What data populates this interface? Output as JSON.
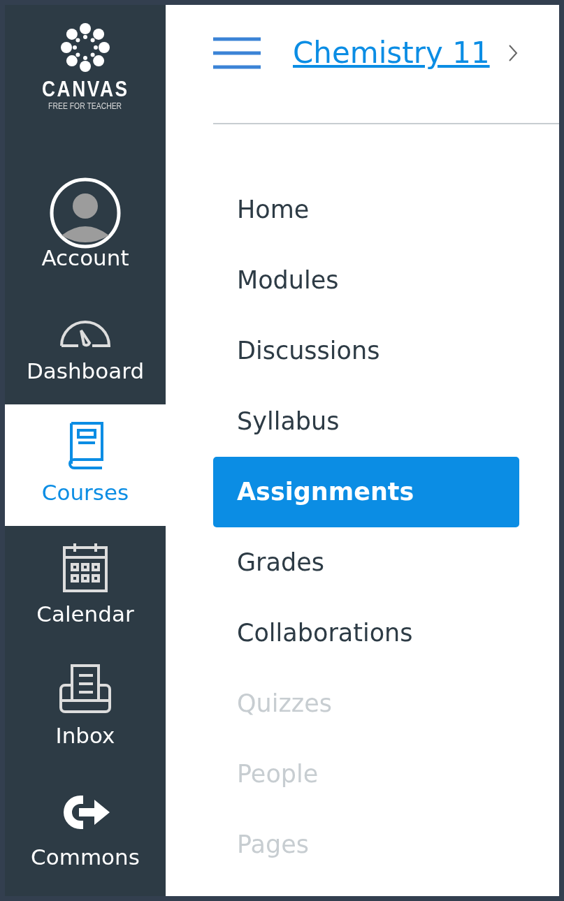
{
  "logo": {
    "title": "CANVAS",
    "subtitle": "FREE FOR TEACHER"
  },
  "global_nav": [
    {
      "kind": "account",
      "label": "Account",
      "selected": false
    },
    {
      "kind": "dashboard",
      "label": "Dashboard",
      "selected": false
    },
    {
      "kind": "courses",
      "label": "Courses",
      "selected": true
    },
    {
      "kind": "calendar",
      "label": "Calendar",
      "selected": false
    },
    {
      "kind": "inbox",
      "label": "Inbox",
      "selected": false
    },
    {
      "kind": "commons",
      "label": "Commons",
      "selected": false
    }
  ],
  "breadcrumb": {
    "course": "Chemistry 11"
  },
  "course_nav": [
    {
      "label": "Home",
      "selected": false,
      "disabled": false
    },
    {
      "label": "Modules",
      "selected": false,
      "disabled": false
    },
    {
      "label": "Discussions",
      "selected": false,
      "disabled": false
    },
    {
      "label": "Syllabus",
      "selected": false,
      "disabled": false
    },
    {
      "label": "Assignments",
      "selected": true,
      "disabled": false
    },
    {
      "label": "Grades",
      "selected": false,
      "disabled": false
    },
    {
      "label": "Collaborations",
      "selected": false,
      "disabled": false
    },
    {
      "label": "Quizzes",
      "selected": false,
      "disabled": true
    },
    {
      "label": "People",
      "selected": false,
      "disabled": true
    },
    {
      "label": "Pages",
      "selected": false,
      "disabled": true
    }
  ]
}
